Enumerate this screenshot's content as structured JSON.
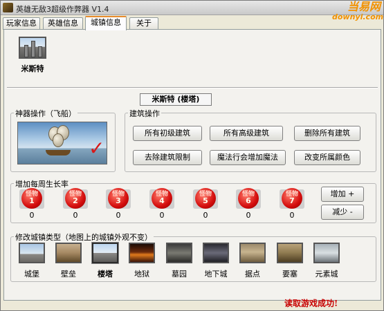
{
  "window": {
    "title": "英雄无敌3超级作弊器 V1.4",
    "brand_main": "当易网",
    "brand_sub": "downyi.com"
  },
  "tabs": [
    {
      "label": "玩家信息"
    },
    {
      "label": "英雄信息"
    },
    {
      "label": "城镇信息"
    },
    {
      "label": "关于"
    }
  ],
  "town": {
    "name": "米斯特",
    "title_box": "米斯特 (楼塔)"
  },
  "artifact_group": {
    "label": "神器操作（飞船）"
  },
  "building_group": {
    "label": "建筑操作",
    "buttons": [
      "所有初级建筑",
      "所有高级建筑",
      "删除所有建筑",
      "去除建筑限制",
      "魔法行会增加魔法",
      "改变所属颜色"
    ]
  },
  "growth_group": {
    "label": "增加每周生长率",
    "orb_text": "怪物",
    "orbs": [
      {
        "num": "1",
        "count": "0"
      },
      {
        "num": "2",
        "count": "0"
      },
      {
        "num": "3",
        "count": "0"
      },
      {
        "num": "4",
        "count": "0"
      },
      {
        "num": "5",
        "count": "0"
      },
      {
        "num": "6",
        "count": "0"
      },
      {
        "num": "7",
        "count": "0"
      }
    ],
    "increase_label": "增加 +",
    "decrease_label": "减少 -"
  },
  "type_group": {
    "label": "修改城镇类型（地图上的城镇外观不变）",
    "types": [
      "城堡",
      "壁垒",
      "楼塔",
      "地狱",
      "墓园",
      "地下城",
      "据点",
      "要塞",
      "元素城"
    ],
    "selected_index": 2
  },
  "status": {
    "message": "读取游戏成功!"
  },
  "colors": {
    "accent": "#e68b2c",
    "status": "#c80000",
    "orb": "#d40d0d"
  }
}
